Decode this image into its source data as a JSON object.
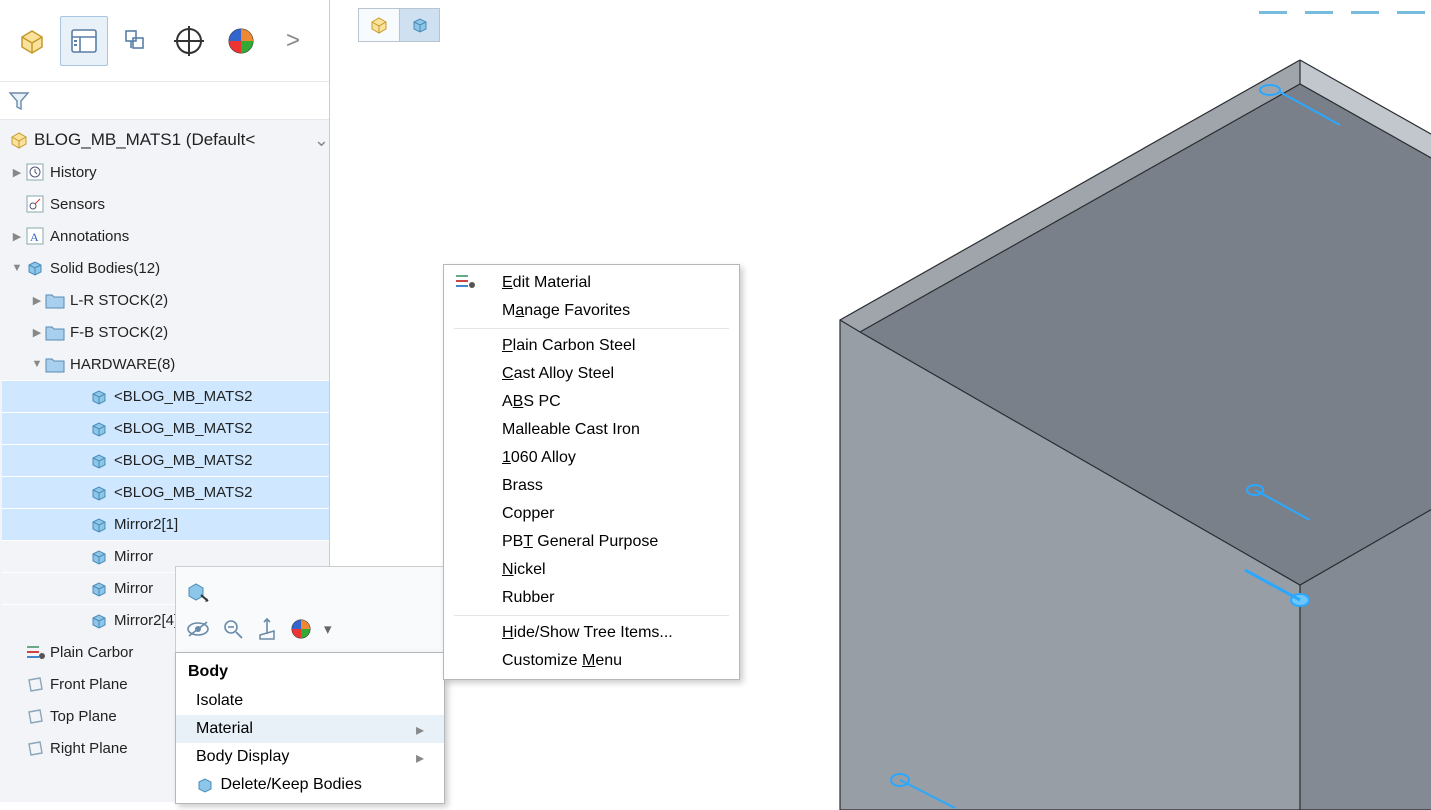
{
  "root": {
    "name": "BLOG_MB_MATS1  (Default<"
  },
  "tree": {
    "history": "History",
    "sensors": "Sensors",
    "annotations": "Annotations",
    "solid_bodies": "Solid Bodies(12)",
    "lr_stock": "L-R STOCK(2)",
    "fb_stock": "F-B STOCK(2)",
    "hardware": "HARDWARE(8)",
    "hw0": "<BLOG_MB_MATS2",
    "hw1": "<BLOG_MB_MATS2",
    "hw2": "<BLOG_MB_MATS2",
    "hw3": "<BLOG_MB_MATS2",
    "hw4": "Mirror2[1]",
    "hw5": "Mirror",
    "hw6": "Mirror",
    "hw7": "Mirror2[4]",
    "material": "Plain Carbor",
    "front_plane": "Front Plane",
    "top_plane": "Top Plane",
    "right_plane": "Right Plane"
  },
  "ctx1": {
    "heading": "Body",
    "isolate": "Isolate",
    "material": "Material",
    "body_display": "Body Display",
    "delete_keep": "Delete/Keep Bodies"
  },
  "ctx2": {
    "edit_material": "Edit Material",
    "manage_fav": "Manage Favorites",
    "plain_carbon": "Plain Carbon Steel",
    "cast_alloy": "Cast Alloy Steel",
    "abs_pc": "ABS PC",
    "malleable": "Malleable Cast Iron",
    "alloy_1060": "1060 Alloy",
    "brass": "Brass",
    "copper": "Copper",
    "pbt": "PBT General Purpose",
    "nickel": "Nickel",
    "rubber": "Rubber",
    "hide_show": "Hide/Show Tree Items...",
    "customize": "Customize Menu"
  }
}
